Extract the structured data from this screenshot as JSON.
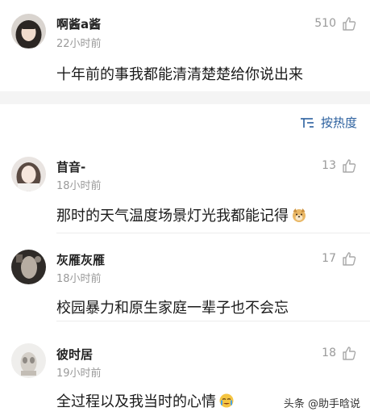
{
  "top_comment": {
    "username": "啊酱a酱",
    "time": "22小时前",
    "likes": "510",
    "text": "十年前的事我都能清清楚楚给你说出来"
  },
  "sort": {
    "label": "按热度"
  },
  "replies": [
    {
      "username": "苜音-",
      "time": "18小时前",
      "likes": "13",
      "text": "那时的天气温度场景灯光我都能记得",
      "emoji": "dog-face-emoji"
    },
    {
      "username": "灰雁灰雁",
      "time": "18小时前",
      "likes": "17",
      "text": "校园暴力和原生家庭一辈子也不会忘"
    },
    {
      "username": "彼时居",
      "time": "19小时前",
      "likes": "18",
      "text": "全过程以及我当时的心情",
      "emoji": "crying-face-emoji"
    }
  ],
  "watermark": "头条 @助手晗说",
  "colors": {
    "accent": "#2a5f9e",
    "meta": "#9a9a9a",
    "band": "#f4f4f4"
  }
}
